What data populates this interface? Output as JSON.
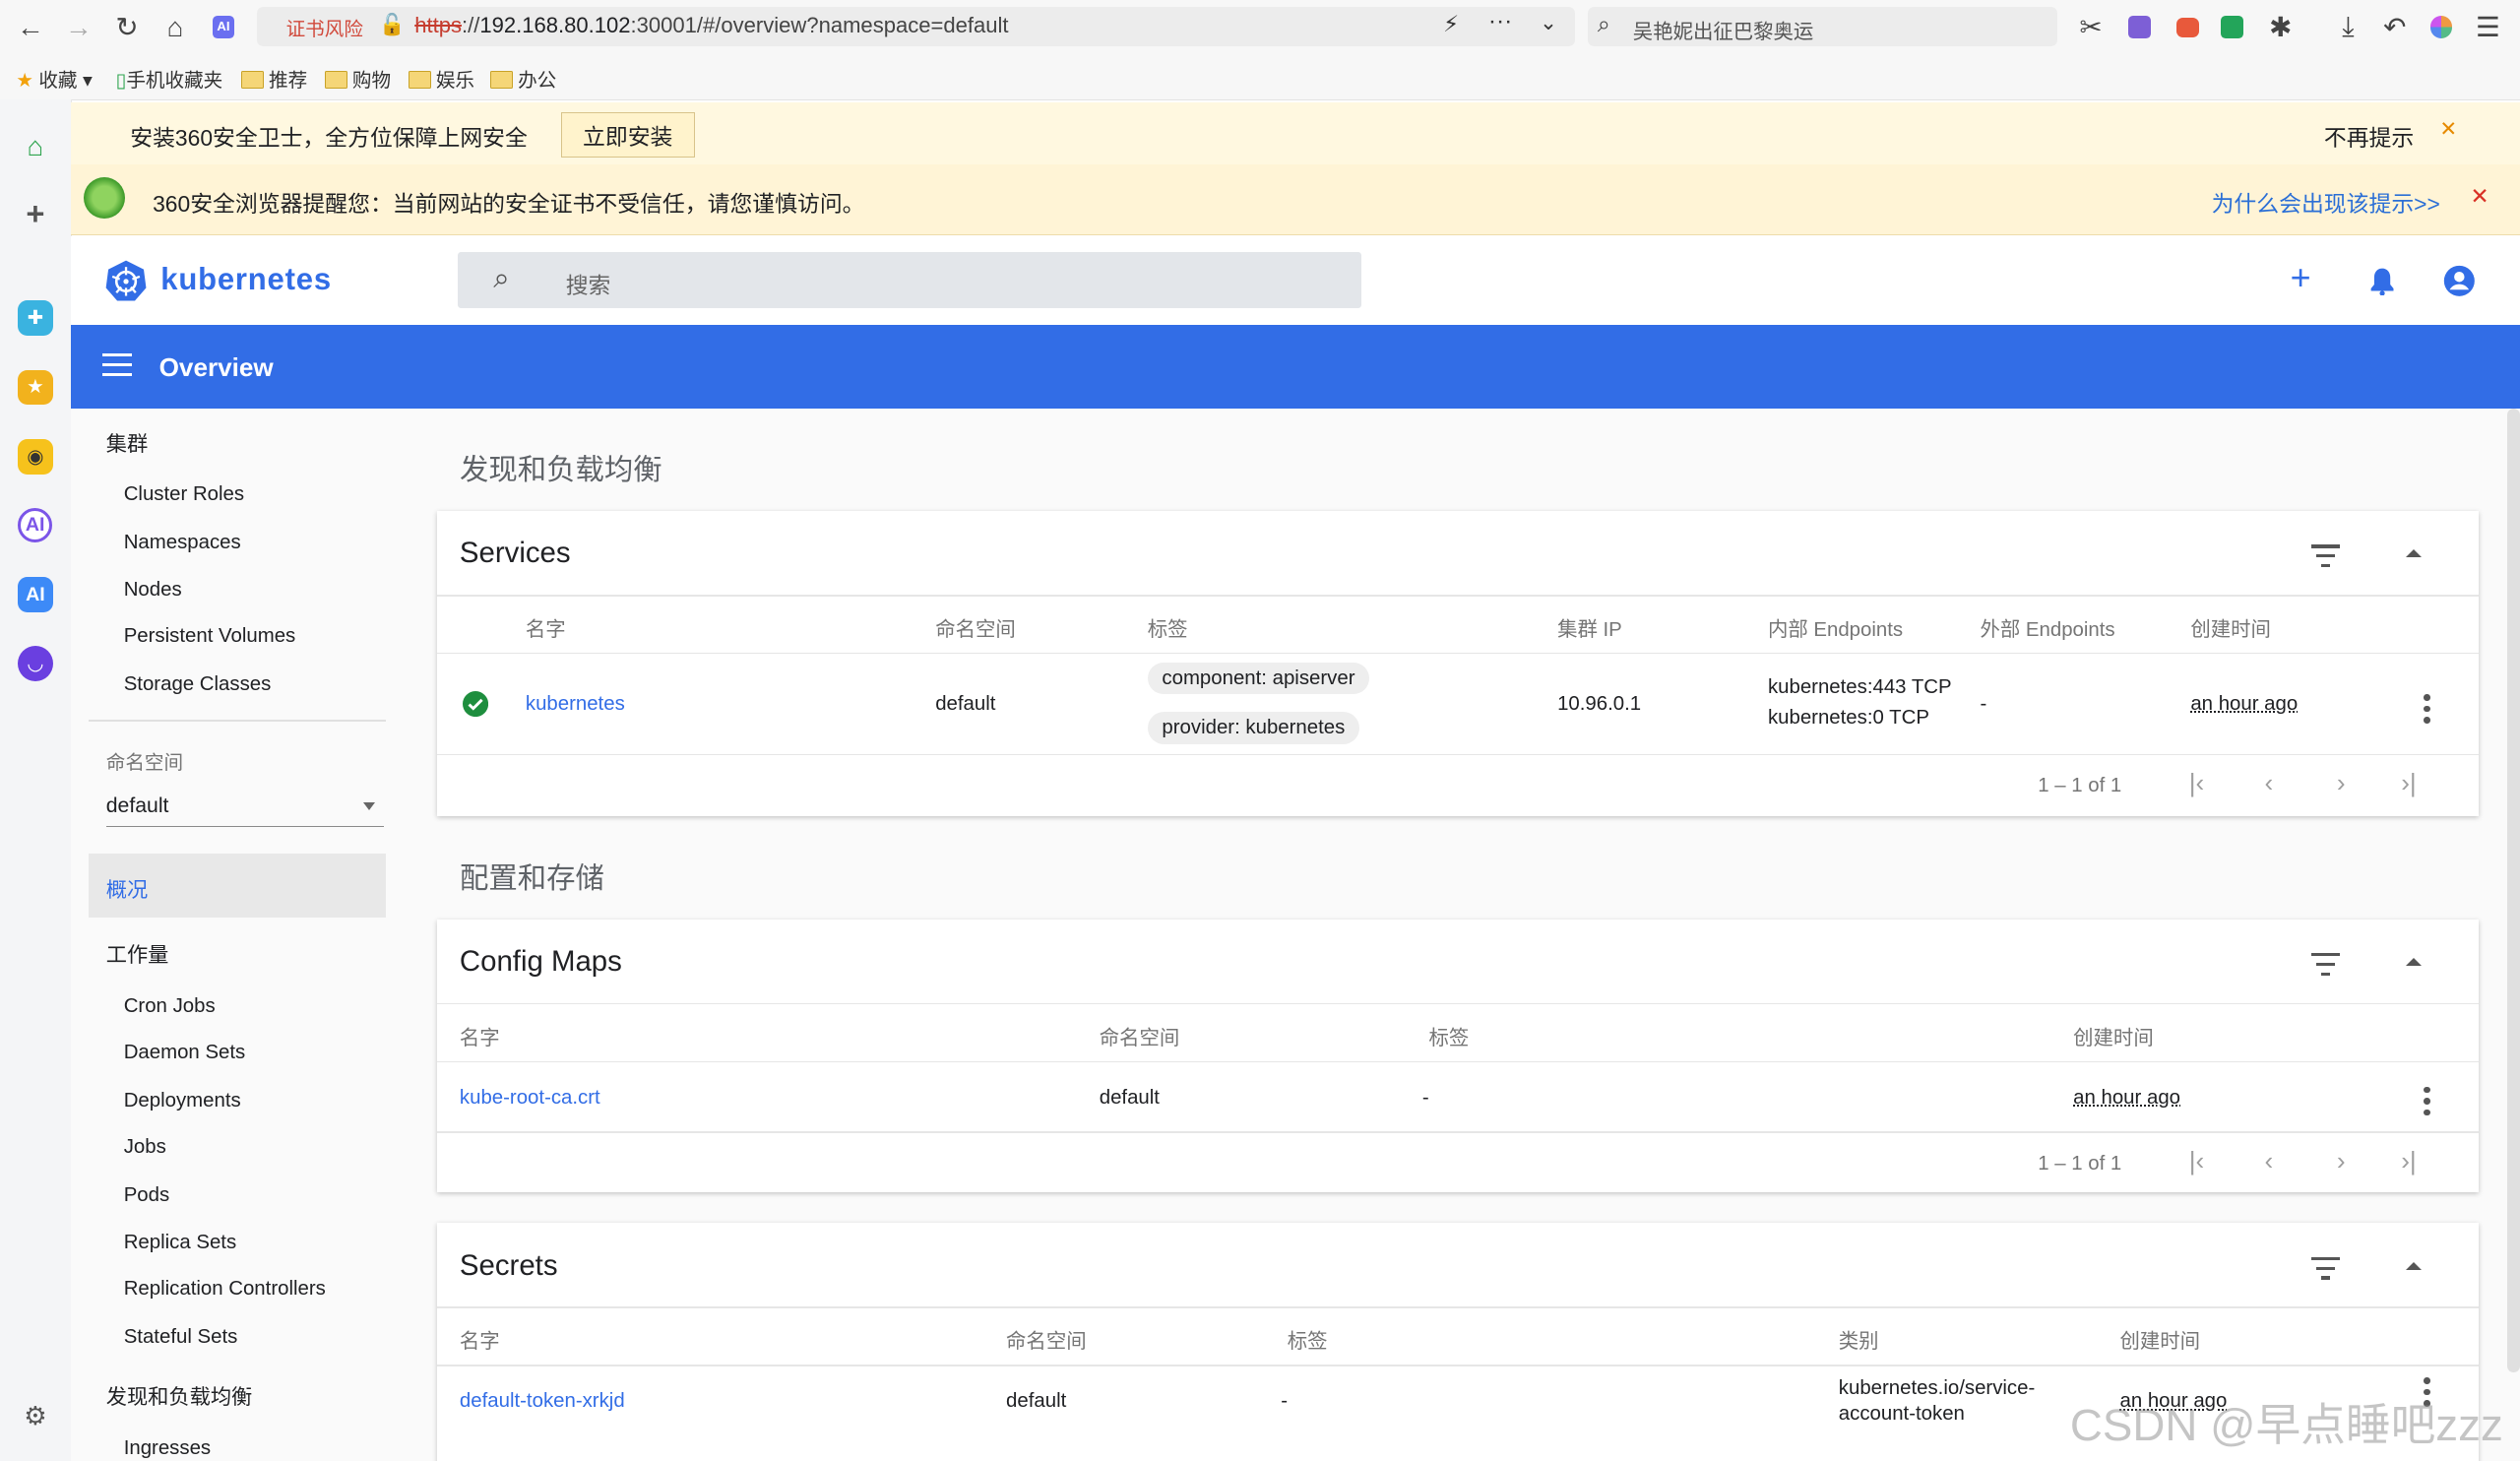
{
  "browser": {
    "cert_badge": "证书风险",
    "url_scheme": "https",
    "url_rest": "://",
    "url_host": "192.168.80.102",
    "url_path": ":30001/#/overview?namespace=default",
    "search_placeholder": "吴艳妮出征巴黎奥运",
    "bookmarks": [
      "收藏",
      "手机收藏夹",
      "推荐",
      "购物",
      "娱乐",
      "办公"
    ]
  },
  "infobar1": {
    "text": "安装360安全卫士，全方位保障上网安全",
    "button": "立即安装",
    "dismiss": "不再提示",
    "close": "✕"
  },
  "infobar2": {
    "text": "360安全浏览器提醒您：当前网站的安全证书不受信任，请您谨慎访问。",
    "link": "为什么会出现该提示>>",
    "close": "✕"
  },
  "header": {
    "logo_text": "kubernetes",
    "search_placeholder": "搜索"
  },
  "toolbar": {
    "title": "Overview"
  },
  "nav": {
    "cluster_title": "集群",
    "cluster_items": [
      "Cluster Roles",
      "Namespaces",
      "Nodes",
      "Persistent Volumes",
      "Storage Classes"
    ],
    "namespace_label": "命名空间",
    "namespace_value": "default",
    "overview": "概况",
    "workloads_title": "工作量",
    "workload_items": [
      "Cron Jobs",
      "Daemon Sets",
      "Deployments",
      "Jobs",
      "Pods",
      "Replica Sets",
      "Replication Controllers",
      "Stateful Sets"
    ],
    "discovery_title": "发现和负载均衡",
    "discovery_items": [
      "Ingresses"
    ]
  },
  "main": {
    "discovery_title": "发现和负载均衡",
    "config_title": "配置和存储",
    "services": {
      "title": "Services",
      "headers": [
        "名字",
        "命名空间",
        "标签",
        "集群 IP",
        "内部 Endpoints",
        "外部 Endpoints",
        "创建时间"
      ],
      "row": {
        "name": "kubernetes",
        "namespace": "default",
        "labels": [
          "component: apiserver",
          "provider: kubernetes"
        ],
        "cluster_ip": "10.96.0.1",
        "internal_endpoints": [
          "kubernetes:443 TCP",
          "kubernetes:0 TCP"
        ],
        "external_endpoints": "-",
        "created": "an hour ago"
      },
      "pagination": "1 – 1 of 1"
    },
    "configmaps": {
      "title": "Config Maps",
      "headers": [
        "名字",
        "命名空间",
        "标签",
        "创建时间"
      ],
      "row": {
        "name": "kube-root-ca.crt",
        "namespace": "default",
        "labels": "-",
        "created": "an hour ago"
      },
      "pagination": "1 – 1 of 1"
    },
    "secrets": {
      "title": "Secrets",
      "headers": [
        "名字",
        "命名空间",
        "标签",
        "类别",
        "创建时间"
      ],
      "row": {
        "name": "default-token-xrkjd",
        "namespace": "default",
        "labels": "-",
        "type_line1": "kubernetes.io/service-",
        "type_line2": "account-token",
        "created": "an hour ago"
      }
    }
  },
  "watermark": "CSDN @早点睡吧zzz",
  "colors": {
    "primary": "#326de6",
    "link": "#326de6",
    "ok": "#1e8e3e",
    "infobar": "#fff4d6"
  }
}
